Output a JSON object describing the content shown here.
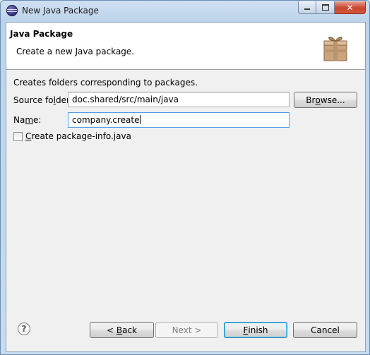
{
  "window": {
    "title": "New Java Package"
  },
  "banner": {
    "title": "Java Package",
    "description": "Create a new Java package."
  },
  "form": {
    "intro": "Creates folders corresponding to packages.",
    "source_folder_label_pre": "Source fo",
    "source_folder_label_mnemonic": "l",
    "source_folder_label_post": "der:",
    "source_folder_value": "doc.shared/src/main/java",
    "browse_label_pre": "Br",
    "browse_label_mnemonic": "o",
    "browse_label_post": "wse...",
    "name_label_pre": "Na",
    "name_label_mnemonic": "m",
    "name_label_post": "e:",
    "name_value": "company.create",
    "package_info_mnemonic": "C",
    "package_info_label_post": "reate package-info.java",
    "package_info_checked": false
  },
  "buttons": {
    "back_pre": "< ",
    "back_mnemonic": "B",
    "back_post": "ack",
    "next_label": "Next >",
    "finish_mnemonic": "F",
    "finish_post": "inish",
    "cancel_label": "Cancel"
  },
  "icons": {
    "app": "eclipse-icon",
    "banner": "package-icon",
    "help": "help-icon"
  },
  "colors": {
    "title_bar": "#bcd3ea",
    "close_button": "#c7452f",
    "default_button_border": "#3c7fb1",
    "focused_input_border": "#569de5"
  }
}
